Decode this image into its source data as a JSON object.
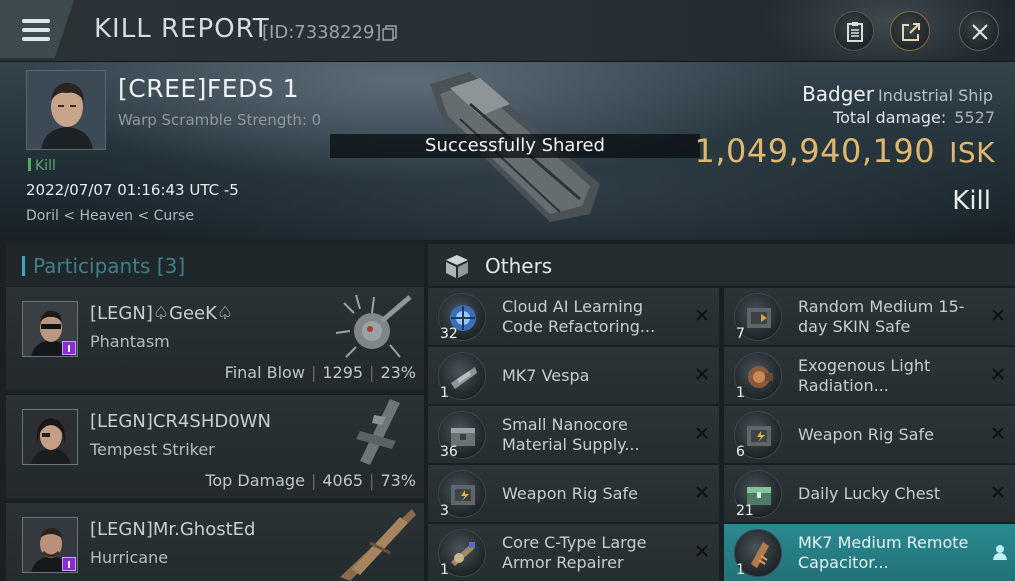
{
  "header": {
    "title": "KILL REPORT",
    "report_id": "[ID:7338229]"
  },
  "victim": {
    "name": "[CREE]FEDS 1",
    "warp_scramble": "Warp Scramble Strength: 0",
    "status_tag": "Kill",
    "timestamp": "2022/07/07 01:16:43 UTC -5",
    "location": "Doril < Heaven < Curse",
    "ship_name": "Badger",
    "ship_class": "Industrial Ship",
    "total_damage_label": "Total damage:",
    "total_damage": "5527",
    "isk_value": "1,049,940,190",
    "isk_unit": "ISK",
    "result": "Kill"
  },
  "notice": "Successfully Shared",
  "participants": {
    "title": "Participants [3]",
    "rows": [
      {
        "name": "[LEGN]♤GeeK♤",
        "ship": "Phantasm",
        "role": "Final Blow",
        "damage": "1295",
        "percent": "23%"
      },
      {
        "name": "[LEGN]CR4SHD0WN",
        "ship": "Tempest Striker",
        "role": "Top Damage",
        "damage": "4065",
        "percent": "73%"
      },
      {
        "name": "[LEGN]Mr.GhostEd",
        "ship": "Hurricane",
        "role": "",
        "damage": "",
        "percent": ""
      }
    ]
  },
  "others": {
    "title": "Others",
    "items": [
      {
        "qty": "32",
        "name": "Cloud AI Learning Code Refactoring...",
        "icon": "ai-chip-icon"
      },
      {
        "qty": "7",
        "name": "Random Medium 15-day SKIN Safe",
        "icon": "safe-icon"
      },
      {
        "qty": "1",
        "name": "MK7  Vespa",
        "icon": "drone-icon"
      },
      {
        "qty": "1",
        "name": "Exogenous Light Radiation...",
        "icon": "module-icon"
      },
      {
        "qty": "36",
        "name": "Small Nanocore Material Supply...",
        "icon": "crate-icon"
      },
      {
        "qty": "6",
        "name": "Weapon Rig Safe",
        "icon": "safe-icon"
      },
      {
        "qty": "3",
        "name": "Weapon Rig Safe",
        "icon": "safe-icon"
      },
      {
        "qty": "21",
        "name": "Daily Lucky Chest",
        "icon": "chest-icon"
      },
      {
        "qty": "1",
        "name": "Core C-Type Large Armor Repairer",
        "icon": "repairer-icon"
      },
      {
        "qty": "1",
        "name": "MK7 Medium Remote Capacitor...",
        "icon": "capacitor-icon"
      }
    ]
  },
  "colors": {
    "isk_gold": "#e1b66f",
    "kill_green": "#5aa86a",
    "participants_accent": "#3da9ba",
    "highlight_teal": "#2a8a91",
    "badge_purple": "#8a2bd6"
  }
}
